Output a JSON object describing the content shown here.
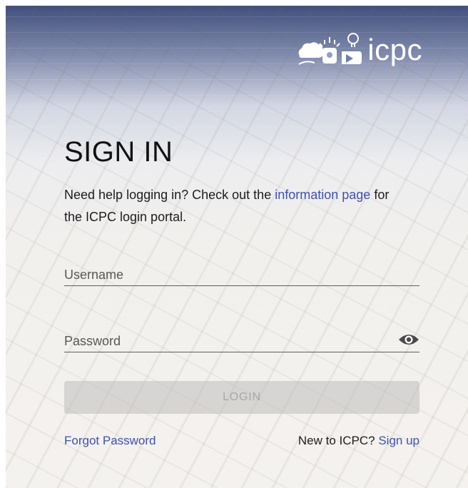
{
  "brand": {
    "logo_text": "icpc"
  },
  "signin": {
    "title": "SIGN IN",
    "help_prefix": "Need help logging in? Check out the",
    "help_link": "information page",
    "help_suffix": "for the ICPC login portal."
  },
  "form": {
    "username_placeholder": "Username",
    "password_placeholder": "Password",
    "login_label": "LOGIN"
  },
  "footer": {
    "forgot_label": "Forgot Password",
    "new_prompt": "New to ICPC?",
    "signup_label": "Sign up"
  },
  "colors": {
    "link": "#3f51b5",
    "header_blue": "#3a4878",
    "button_disabled": "#bebebe"
  },
  "icons": [
    "icpc-logo-icon",
    "eye-icon"
  ]
}
